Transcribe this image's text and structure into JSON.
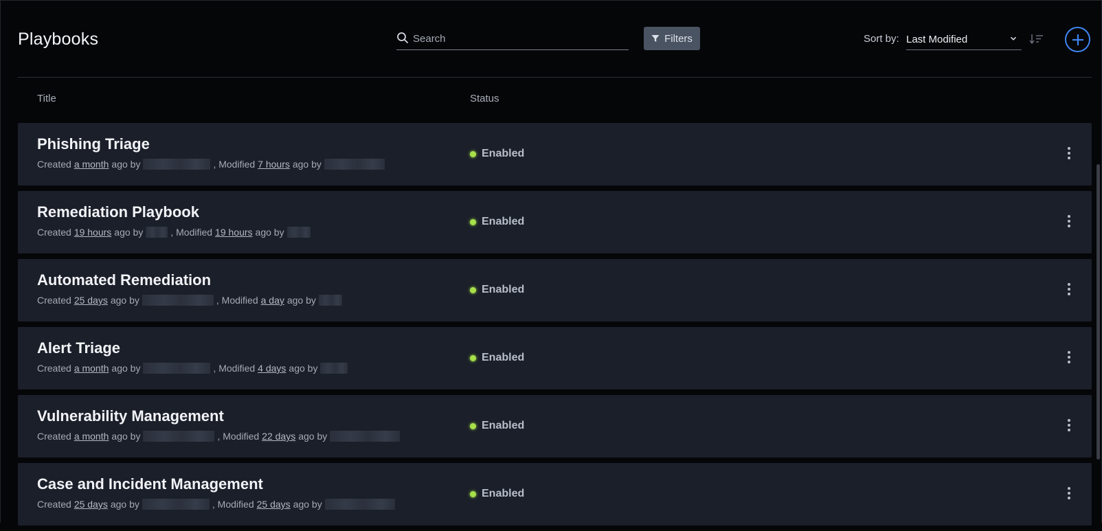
{
  "header": {
    "title": "Playbooks",
    "search_placeholder": "Search",
    "filters_label": "Filters",
    "sort_label": "Sort by:",
    "sort_value": "Last Modified"
  },
  "columns": {
    "title": "Title",
    "status": "Status"
  },
  "colors": {
    "accent": "#3f86f2",
    "status_enabled": "#a7e04a",
    "row_bg": "#1b1f29"
  },
  "icons": {
    "search": "search-icon",
    "filter": "filter-icon",
    "chevron": "chevron-down-icon",
    "sort_direction": "sort-descending-icon",
    "add": "plus-icon",
    "more": "more-vertical-icon"
  },
  "playbooks": [
    {
      "title": "Phishing Triage",
      "created_label": "Created",
      "created_ago": "a month",
      "ago_by": "ago by",
      "modified_label": ", Modified",
      "modified_ago": "7 hours",
      "modified_by": "ago by",
      "status": "Enabled"
    },
    {
      "title": "Remediation Playbook",
      "created_label": "Created",
      "created_ago": "19 hours",
      "ago_by": "ago by",
      "modified_label": ", Modified",
      "modified_ago": "19 hours",
      "modified_by": "ago by",
      "status": "Enabled"
    },
    {
      "title": "Automated Remediation",
      "created_label": "Created",
      "created_ago": "25 days",
      "ago_by": "ago by",
      "modified_label": ", Modified",
      "modified_ago": "a day",
      "modified_by": "ago by",
      "status": "Enabled"
    },
    {
      "title": "Alert Triage",
      "created_label": "Created",
      "created_ago": "a month",
      "ago_by": "ago by",
      "modified_label": ", Modified",
      "modified_ago": "4 days",
      "modified_by": "ago by",
      "status": "Enabled"
    },
    {
      "title": "Vulnerability Management",
      "created_label": "Created",
      "created_ago": "a month",
      "ago_by": "ago by",
      "modified_label": ", Modified",
      "modified_ago": "22 days",
      "modified_by": "ago by",
      "status": "Enabled"
    },
    {
      "title": "Case and Incident Management",
      "created_label": "Created",
      "created_ago": "25 days",
      "ago_by": "ago by",
      "modified_label": ", Modified",
      "modified_ago": "25 days",
      "modified_by": "ago by",
      "status": "Enabled"
    }
  ]
}
